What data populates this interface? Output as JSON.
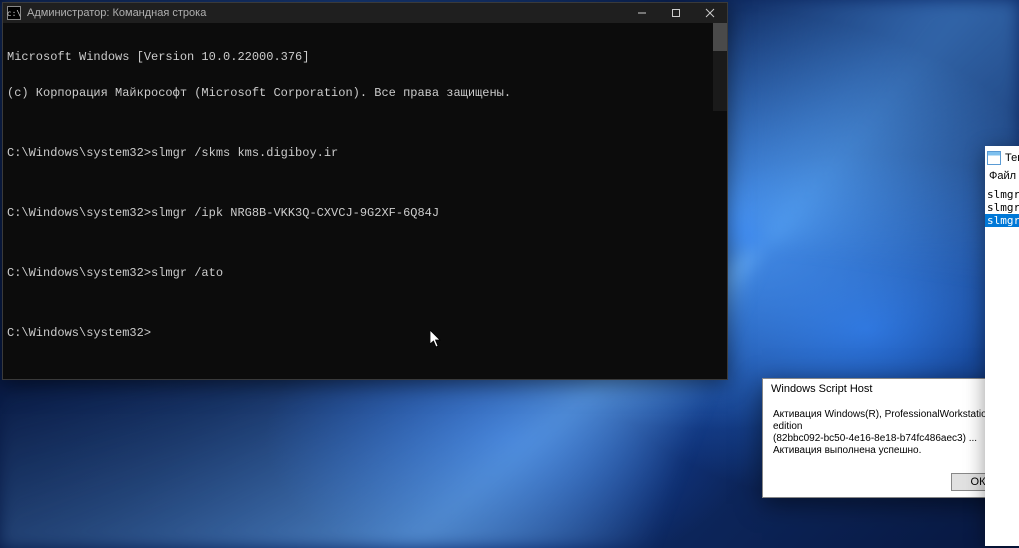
{
  "terminal": {
    "title": "Администратор: Командная строка",
    "lines": [
      "Microsoft Windows [Version 10.0.22000.376]",
      "(c) Корпорация Майкрософт (Microsoft Corporation). Все права защищены.",
      "",
      "C:\\Windows\\system32>slmgr /skms kms.digiboy.ir",
      "",
      "C:\\Windows\\system32>slmgr /ipk NRG8B-VKK3Q-CXVCJ-9G2XF-6Q84J",
      "",
      "C:\\Windows\\system32>slmgr /ato",
      "",
      "C:\\Windows\\system32>"
    ]
  },
  "dialog": {
    "title": "Windows Script Host",
    "line1": "Активация Windows(R), ProfessionalWorkstation edition",
    "line2": "(82bbc092-bc50-4e16-8e18-b74fc486aec3) ...",
    "line3": "Активация выполнена успешно.",
    "ok": "ОК"
  },
  "notepad": {
    "title": "Тек",
    "menu": "Файл",
    "lines": [
      "slmgr",
      "slmgr",
      "slmgr"
    ],
    "selected_index": 2
  }
}
